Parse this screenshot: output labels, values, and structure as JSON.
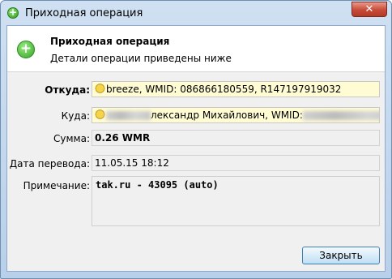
{
  "window": {
    "title": "Приходная операция",
    "close_glyph": "✕"
  },
  "header": {
    "icon": "plus-circle-icon",
    "title": "Приходная операция",
    "subtitle": "Детали операции приведены ниже"
  },
  "form": {
    "from_label": "Откуда:",
    "from_value": "breeze, WMID: 086866180559, R147197919032",
    "to_label": "Куда:",
    "to_value": "лександр Михайлович, WMID:",
    "amount_label": "Сумма:",
    "amount_value": "0.26 WMR",
    "date_label": "Дата перевода:",
    "date_value": "11.05.15 18:12",
    "note_label": "Примечание:",
    "note_value": "tak.ru - 43095  (auto)"
  },
  "buttons": {
    "close_label": "Закрыть"
  },
  "colors": {
    "field_highlight": "#fffcd4",
    "accent_green": "#32a322"
  }
}
